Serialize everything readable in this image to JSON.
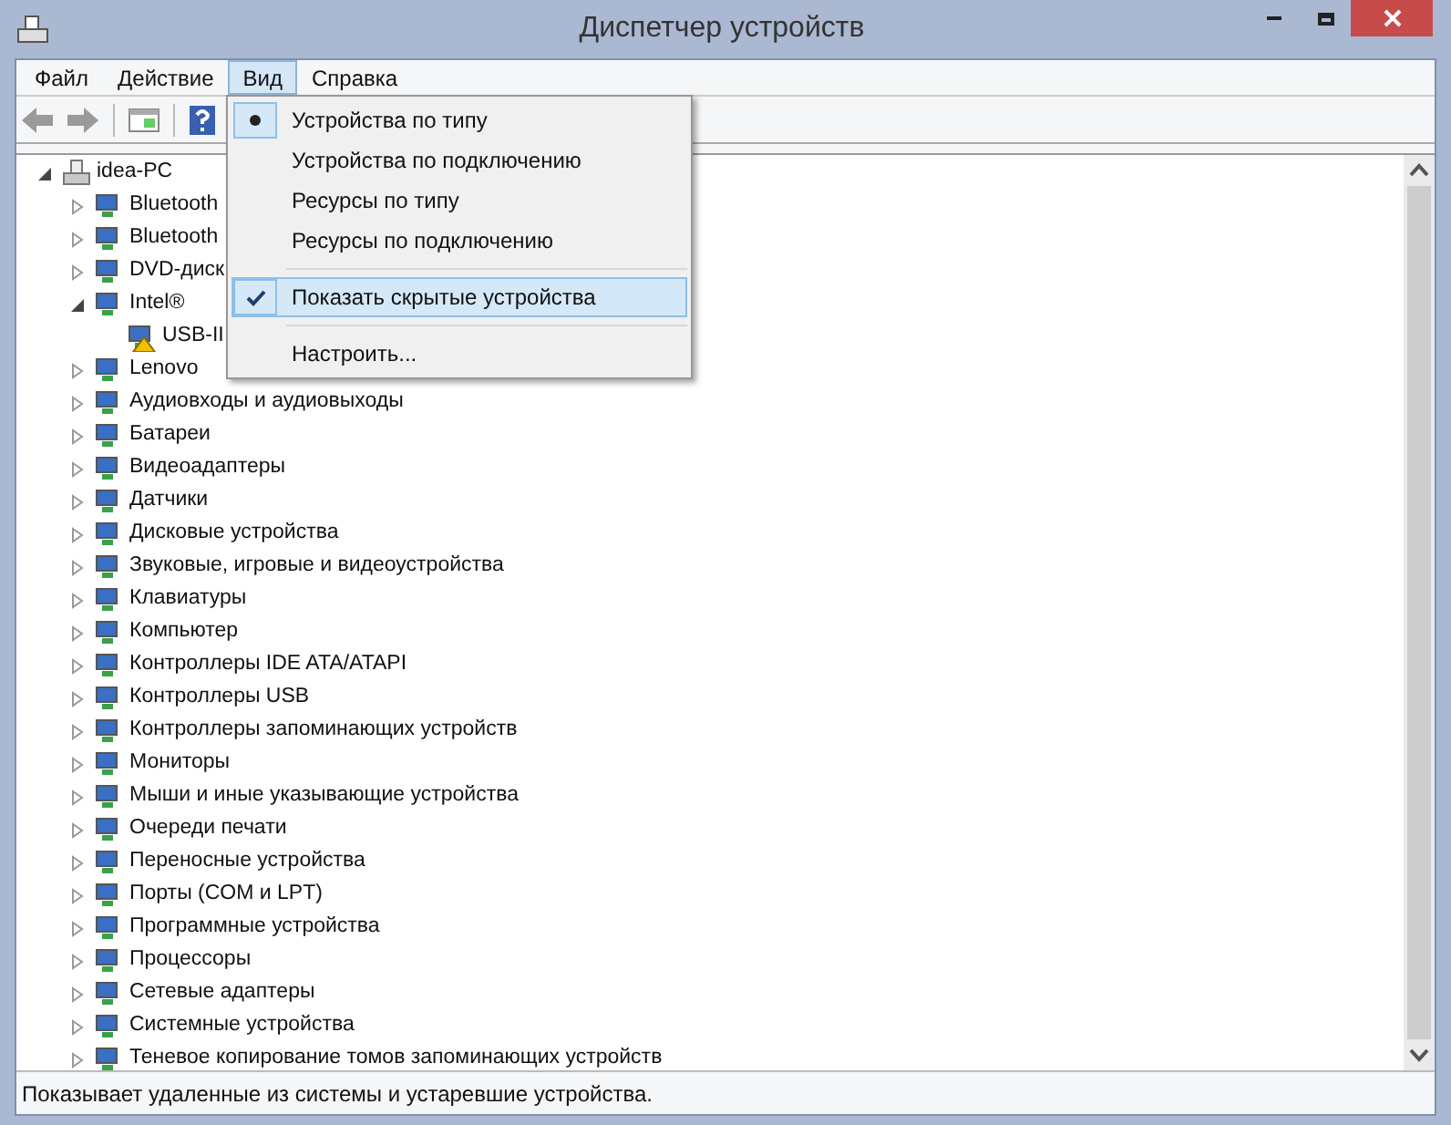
{
  "window": {
    "title": "Диспетчер устройств"
  },
  "menu_bar": [
    {
      "label": "Файл",
      "selected": false
    },
    {
      "label": "Действие",
      "selected": false
    },
    {
      "label": "Вид",
      "selected": true
    },
    {
      "label": "Справка",
      "selected": false
    }
  ],
  "view_menu": [
    {
      "kind": "radio",
      "label": "Устройства по типу",
      "selected": true,
      "highlighted": false
    },
    {
      "kind": "radio",
      "label": "Устройства по подключению",
      "selected": false,
      "highlighted": false
    },
    {
      "kind": "radio",
      "label": "Ресурсы по типу",
      "selected": false,
      "highlighted": false
    },
    {
      "kind": "radio",
      "label": "Ресурсы по подключению",
      "selected": false,
      "highlighted": false
    },
    {
      "kind": "separator"
    },
    {
      "kind": "check",
      "label": "Показать скрытые устройства",
      "checked": true,
      "highlighted": true
    },
    {
      "kind": "separator"
    },
    {
      "kind": "command",
      "label": "Настроить...",
      "highlighted": false
    }
  ],
  "tree": [
    {
      "label": "idea-PC",
      "expanded": true,
      "children": [
        {
          "label": "Bluetooth",
          "expanded": false
        },
        {
          "label": "Bluetooth",
          "expanded": false
        },
        {
          "label": "DVD-диск",
          "expanded": false
        },
        {
          "label": "Intel®",
          "expanded": true,
          "children": [
            {
              "label": "USB-II",
              "warning": true
            }
          ]
        },
        {
          "label": "Lenovo",
          "expanded": false
        },
        {
          "label": "Аудиовходы и аудиовыходы",
          "expanded": false
        },
        {
          "label": "Батареи",
          "expanded": false
        },
        {
          "label": "Видеоадаптеры",
          "expanded": false
        },
        {
          "label": "Датчики",
          "expanded": false
        },
        {
          "label": "Дисковые устройства",
          "expanded": false
        },
        {
          "label": "Звуковые, игровые и видеоустройства",
          "expanded": false
        },
        {
          "label": "Клавиатуры",
          "expanded": false
        },
        {
          "label": "Компьютер",
          "expanded": false
        },
        {
          "label": "Контроллеры IDE ATA/ATAPI",
          "expanded": false
        },
        {
          "label": "Контроллеры USB",
          "expanded": false
        },
        {
          "label": "Контроллеры запоминающих устройств",
          "expanded": false
        },
        {
          "label": "Мониторы",
          "expanded": false
        },
        {
          "label": "Мыши и иные указывающие устройства",
          "expanded": false
        },
        {
          "label": "Очереди печати",
          "expanded": false
        },
        {
          "label": "Переносные устройства",
          "expanded": false
        },
        {
          "label": "Порты (COM и LPT)",
          "expanded": false
        },
        {
          "label": "Программные устройства",
          "expanded": false
        },
        {
          "label": "Процессоры",
          "expanded": false
        },
        {
          "label": "Сетевые адаптеры",
          "expanded": false
        },
        {
          "label": "Системные устройства",
          "expanded": false
        },
        {
          "label": "Теневое копирование томов запоминающих устройств",
          "expanded": false
        }
      ]
    }
  ],
  "status_bar": "Показывает удаленные из системы и устаревшие устройства."
}
